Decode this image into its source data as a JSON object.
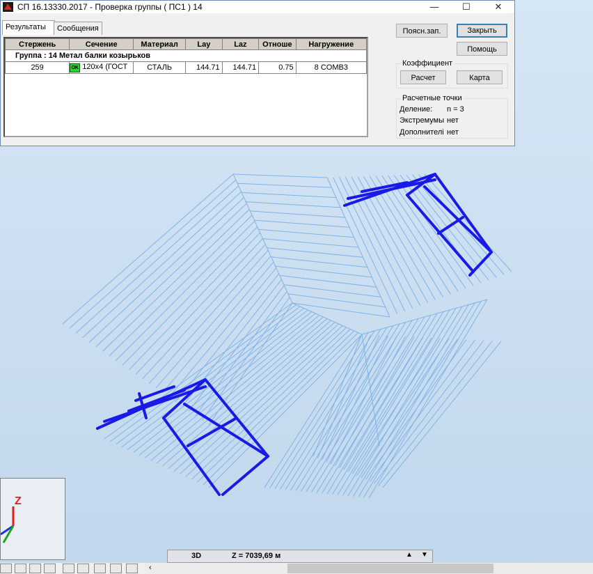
{
  "window": {
    "title": "СП 16.13330.2017 - Проверка группы ( ПС1 ) 14",
    "minimize": "—",
    "maximize": "☐",
    "close": "✕"
  },
  "tabs": [
    {
      "label": "Результаты",
      "active": true
    },
    {
      "label": "Сообщения",
      "active": false
    }
  ],
  "table": {
    "headers": [
      "Стержень",
      "Сечение",
      "Материал",
      "Lay",
      "Laz",
      "Отноше",
      "Нагружение"
    ],
    "group_row": "Группа :  14  Метал балки козырьков",
    "rows": [
      {
        "rod": "259",
        "status": "OK",
        "section": "120x4 (ГОСТ",
        "material": "СТАЛЬ",
        "lay": "144.71",
        "laz": "144.71",
        "ratio": "0.75",
        "load": "8 COMB3"
      }
    ]
  },
  "buttons": {
    "report": "Поясн.зап.",
    "close": "Закрыть",
    "help": "Помощь",
    "calc": "Расчет",
    "map": "Карта"
  },
  "coef": {
    "title": "Коэффициент"
  },
  "points": {
    "title": "Расчетные точки",
    "division_label": "Деление:",
    "division_value": "n = 3",
    "extremes_label": "Экстремумы",
    "extremes_value": "нет",
    "extra_label": "Дополнителі",
    "extra_value": "нет"
  },
  "axes": {
    "z_label": "Z"
  },
  "status": {
    "mode": "3D",
    "z_value": "Z = 7039,69 м"
  },
  "colors": {
    "mesh": "#7fb3ea",
    "beams": "#1a1ae6",
    "background": "#c7dcef",
    "accent": "#3c7fb1"
  }
}
